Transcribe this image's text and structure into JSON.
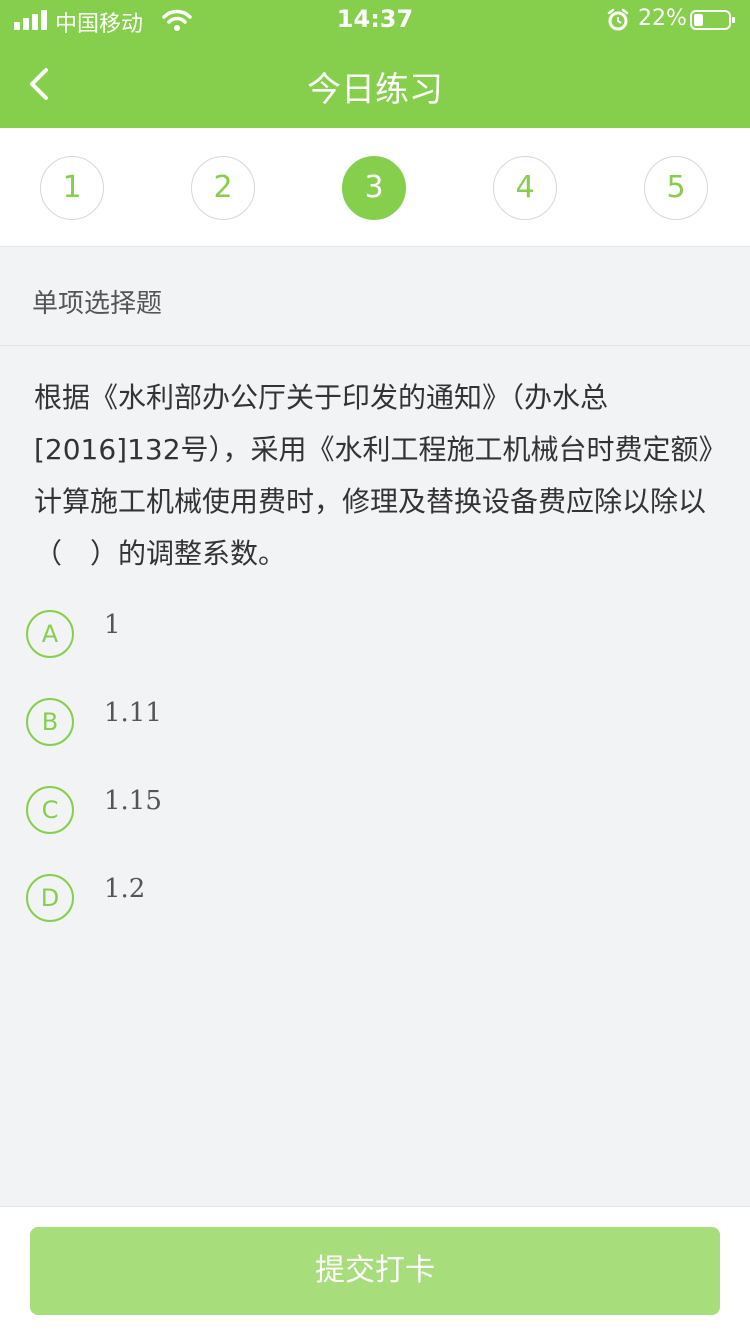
{
  "status_bar": {
    "carrier": "中国移动",
    "time": "14:37",
    "battery": "22%"
  },
  "nav": {
    "title": "今日练习",
    "back_icon": "chevron-left-icon"
  },
  "steps": [
    {
      "label": "1",
      "active": false
    },
    {
      "label": "2",
      "active": false
    },
    {
      "label": "3",
      "active": true
    },
    {
      "label": "4",
      "active": false
    },
    {
      "label": "5",
      "active": false
    }
  ],
  "question_type": "单项选择题",
  "question_text": "根据《水利部办公厅关于印发的通知》（办水总[2016]132号），采用《水利工程施工机械台时费定额》计算施工机械使用费时，修理及替换设备费应除以除以（　）的调整系数。",
  "options": [
    {
      "letter": "A",
      "text": "1"
    },
    {
      "letter": "B",
      "text": "1.11"
    },
    {
      "letter": "C",
      "text": "1.15"
    },
    {
      "letter": "D",
      "text": "1.2"
    }
  ],
  "submit_label": "提交打卡",
  "colors": {
    "accent": "#86cf4c",
    "button_disabled": "#a8dd7c",
    "background": "#f2f3f5"
  }
}
